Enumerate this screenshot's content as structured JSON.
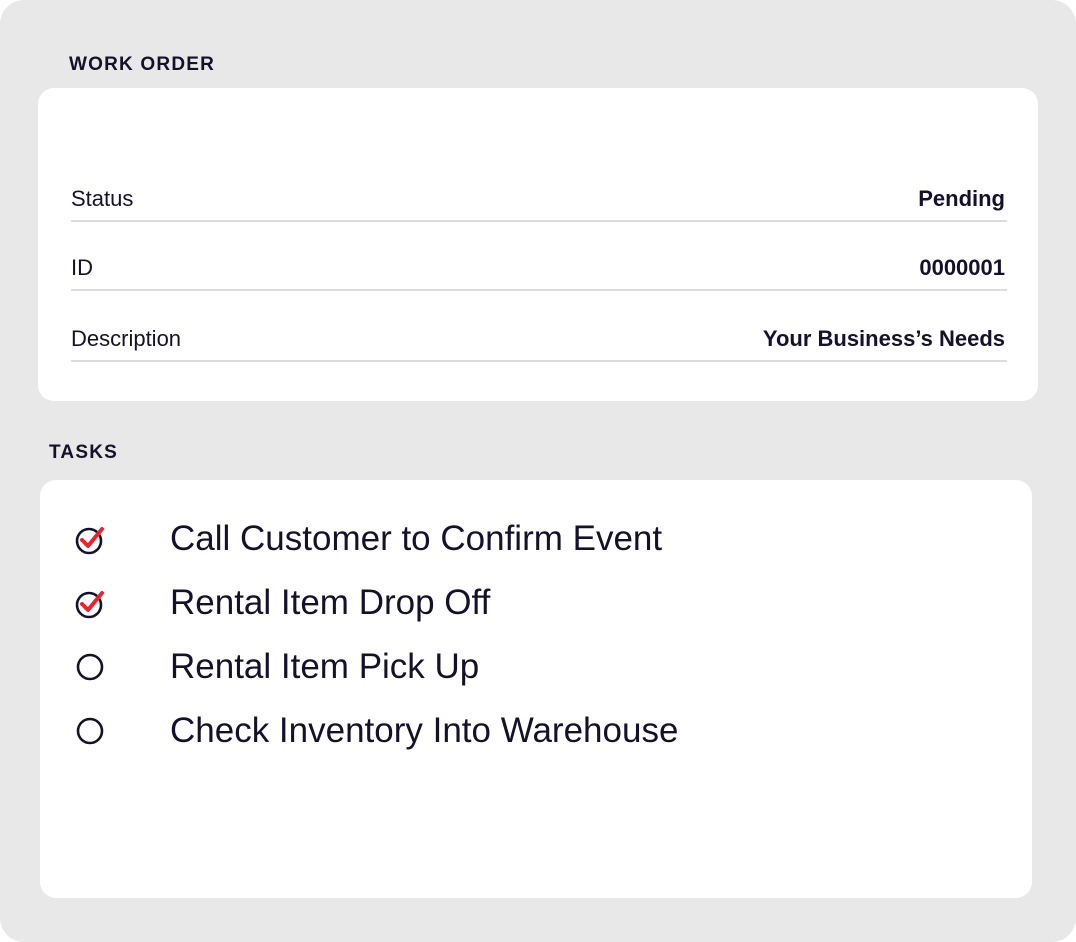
{
  "work_order": {
    "section_label": "WORK ORDER",
    "fields": {
      "status": {
        "label": "Status",
        "value": "Pending"
      },
      "id": {
        "label": "ID",
        "value": "0000001"
      },
      "description": {
        "label": "Description",
        "value": "Your Business’s Needs"
      }
    }
  },
  "tasks": {
    "section_label": "TASKS",
    "items": [
      {
        "label": "Call Customer to Confirm Event",
        "completed": true,
        "icon": "checked-circle-icon"
      },
      {
        "label": "Rental Item Drop Off",
        "completed": true,
        "icon": "checked-circle-icon"
      },
      {
        "label": "Rental Item Pick Up",
        "completed": false,
        "icon": "empty-circle-icon"
      },
      {
        "label": "Check Inventory Into Warehouse",
        "completed": false,
        "icon": "empty-circle-icon"
      }
    ]
  },
  "colors": {
    "background": "#e8e8e8",
    "card": "#ffffff",
    "text": "#14112a",
    "divider": "#dcdcdc",
    "check_accent": "#e8232a"
  }
}
